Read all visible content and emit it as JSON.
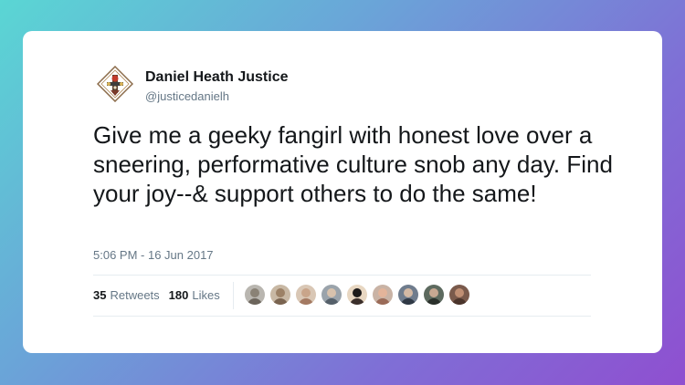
{
  "tweet": {
    "author_name": "Daniel Heath Justice",
    "author_handle": "@justicedanielh",
    "text": "Give me a geeky fangirl with honest love over a sneering, performative culture snob any day. Find your joy--& support others to do the same!",
    "timestamp": "5:06 PM - 16 Jun 2017"
  },
  "stats": {
    "retweets_count": "35",
    "retweets_label": "Retweets",
    "likes_count": "180",
    "likes_label": "Likes"
  },
  "likers": [
    {
      "icon": "avatar-icon",
      "bg": "#b9b6b0",
      "face": "#8a8276",
      "body": "#6c655c"
    },
    {
      "icon": "avatar-icon",
      "bg": "#c8b8a4",
      "face": "#9c8166",
      "body": "#7a6450"
    },
    {
      "icon": "avatar-icon",
      "bg": "#d9c7b5",
      "face": "#c9a58a",
      "body": "#a47a62"
    },
    {
      "icon": "avatar-icon",
      "bg": "#9aa3ab",
      "face": "#d8c2ad",
      "body": "#55606a"
    },
    {
      "icon": "avatar-icon",
      "bg": "#e8d7c2",
      "face": "#1c1a1a",
      "body": "#3a2e2a"
    },
    {
      "icon": "avatar-icon",
      "bg": "#c9b3a5",
      "face": "#e3b49a",
      "body": "#9a6b58"
    },
    {
      "icon": "avatar-icon",
      "bg": "#6f7c8d",
      "face": "#d3b9a4",
      "body": "#2f3945"
    },
    {
      "icon": "avatar-icon",
      "bg": "#5d6a5f",
      "face": "#c7a892",
      "body": "#2a302b"
    },
    {
      "icon": "avatar-icon",
      "bg": "#7a5a4c",
      "face": "#c08f74",
      "body": "#4a342b"
    }
  ],
  "colors": {
    "text_primary": "#14171a",
    "text_secondary": "#657786",
    "divider": "#e6ecf0",
    "card_background": "#ffffff"
  }
}
